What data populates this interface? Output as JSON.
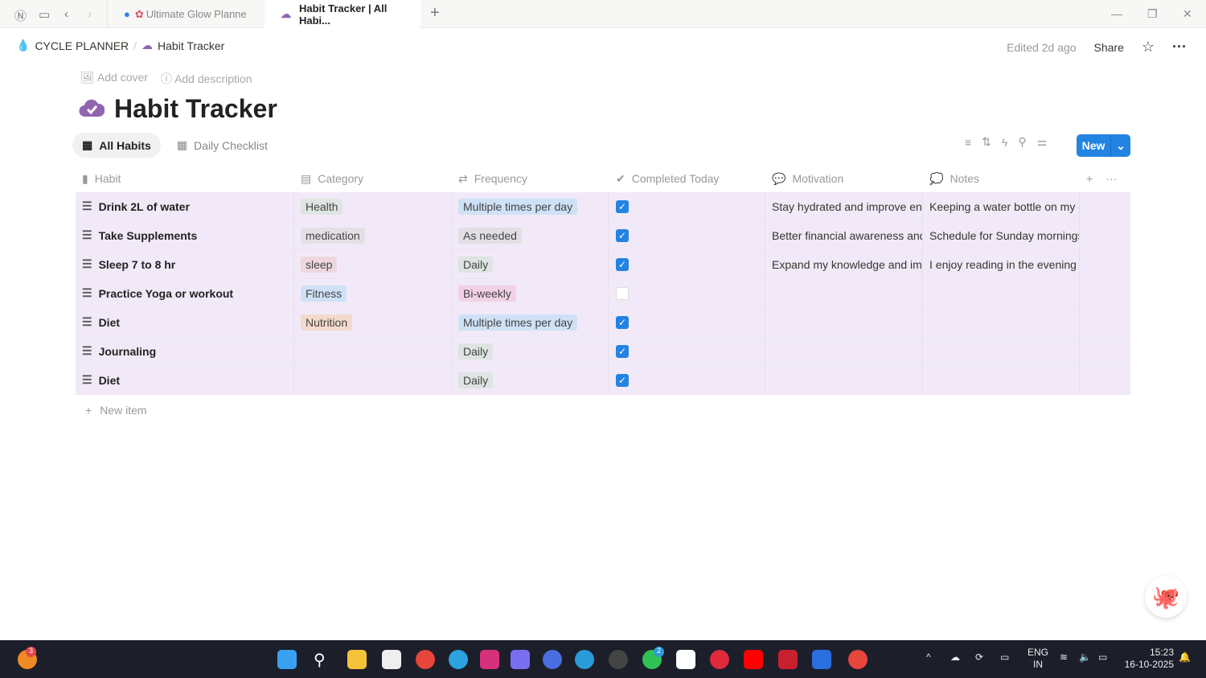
{
  "browser": {
    "tabs": [
      {
        "label": "Ultimate Glow Planne"
      },
      {
        "label": "Habit Tracker | All Habi..."
      }
    ]
  },
  "breadcrumb": {
    "workspace": "CYCLE PLANNER",
    "page": "Habit Tracker"
  },
  "topbar": {
    "edited": "Edited 2d ago",
    "share": "Share"
  },
  "page": {
    "add_cover": "Add cover",
    "add_description": "Add description",
    "title": "Habit Tracker"
  },
  "views": [
    {
      "label": "All Habits"
    },
    {
      "label": "Daily Checklist"
    }
  ],
  "toolbar": {
    "new_label": "New"
  },
  "table": {
    "columns": [
      "Habit",
      "Category",
      "Frequency",
      "Completed Today",
      "Motivation",
      "Notes"
    ],
    "rows": [
      {
        "habit": "Drink 2L of water",
        "category": "Health",
        "frequency": "Multiple times per day",
        "completed": true,
        "motivation": "Stay hydrated and improve ene",
        "notes": "Keeping a water bottle on my d"
      },
      {
        "habit": "Take Supplements",
        "category": "medication",
        "frequency": "As needed",
        "completed": true,
        "motivation": "Better financial awareness and s",
        "notes": "Schedule for Sunday mornings"
      },
      {
        "habit": "Sleep 7 to 8 hr",
        "category": "sleep",
        "frequency": "Daily",
        "completed": true,
        "motivation": "Expand my knowledge and impi",
        "notes": "I enjoy reading in the evening b"
      },
      {
        "habit": "Practice Yoga or workout",
        "category": "Fitness",
        "frequency": "Bi-weekly",
        "completed": false,
        "motivation": "",
        "notes": ""
      },
      {
        "habit": "Diet",
        "category": "Nutrition",
        "frequency": "Multiple times per day",
        "completed": true,
        "motivation": "",
        "notes": ""
      },
      {
        "habit": "Journaling",
        "category": "",
        "frequency": "Daily",
        "completed": true,
        "motivation": "",
        "notes": ""
      },
      {
        "habit": "Diet",
        "category": "",
        "frequency": "Daily",
        "completed": true,
        "motivation": "",
        "notes": ""
      }
    ],
    "new_item": "New item"
  },
  "tag_colors": {
    "Health": "#dfe5e2",
    "medication": "#e4dfe7",
    "sleep": "#eed8dd",
    "Fitness": "#cfe1f6",
    "Nutrition": "#f4dacd",
    "Multiple times per day": "#cfe1f6",
    "As needed": "#e2dfe4",
    "Daily": "#dde4e1",
    "Bi-weekly": "#f2d1e5"
  },
  "taskbar": {
    "badge": "3",
    "whatsapp_badge": "2",
    "lang": "ENG",
    "region": "IN",
    "time": "15:23",
    "date": "16-10-2025"
  }
}
